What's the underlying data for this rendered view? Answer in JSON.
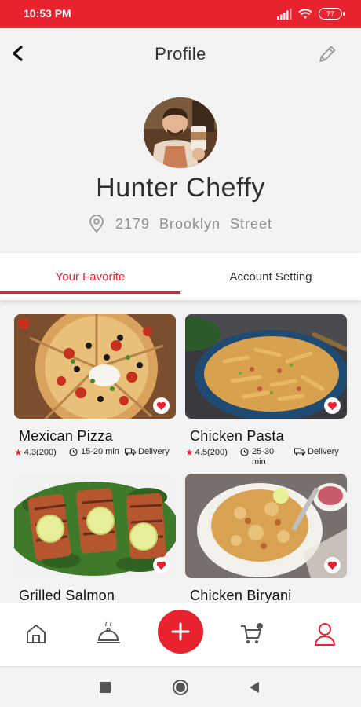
{
  "status_bar": {
    "time": "10:53 PM",
    "battery": "77"
  },
  "header": {
    "title": "Profile"
  },
  "profile": {
    "name": "Hunter Cheffy",
    "address": "2179  Brooklyn  Street"
  },
  "tabs": [
    {
      "label": "Your Favorite",
      "active": true
    },
    {
      "label": "Account Setting",
      "active": false
    }
  ],
  "favorites": [
    {
      "name": "Mexican Pizza",
      "rating": "4.3(200)",
      "time": "15-20 min",
      "delivery": "Delivery"
    },
    {
      "name": "Chicken Pasta",
      "rating": "4.5(200)",
      "time": "25-30 min",
      "delivery": "Delivery"
    },
    {
      "name": "Grilled Salmon",
      "rating": "",
      "time": "",
      "delivery": ""
    },
    {
      "name": "Chicken Biryani",
      "rating": "",
      "time": "",
      "delivery": ""
    }
  ],
  "bottom_nav": [
    "home-icon",
    "cloche-icon",
    "add-icon",
    "cart-icon",
    "profile-icon"
  ],
  "colors": {
    "accent": "#e8232f",
    "text": "#2f2f2f",
    "muted": "#8d8d8d"
  }
}
